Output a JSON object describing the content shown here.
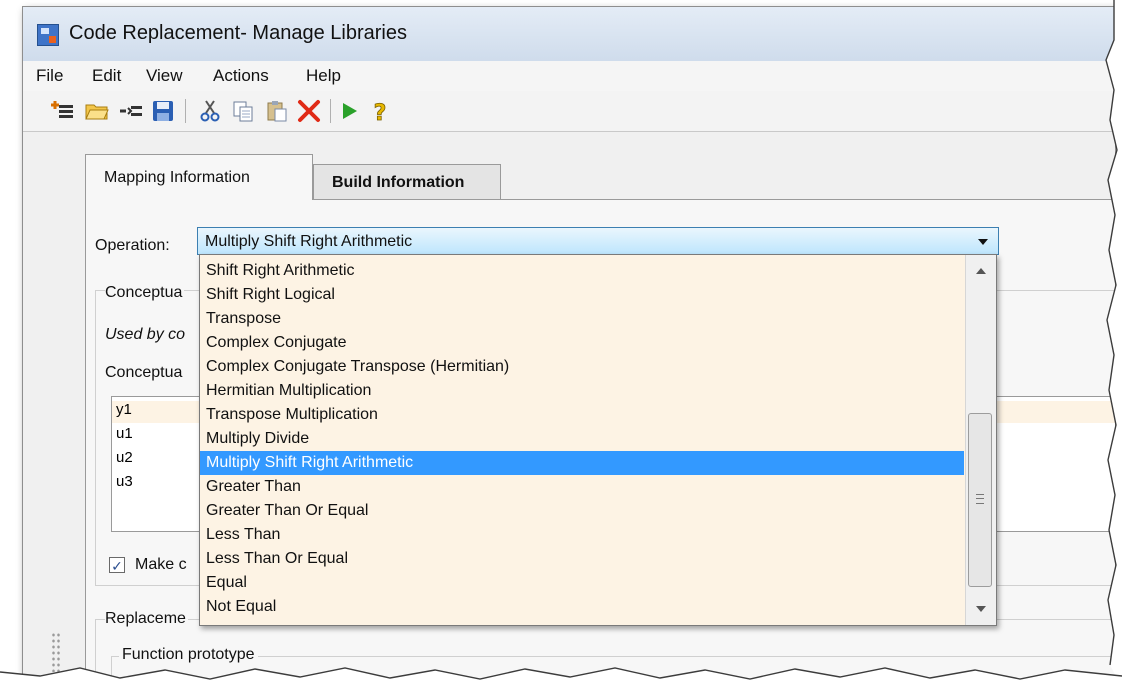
{
  "window": {
    "title": "Code Replacement- Manage Libraries"
  },
  "menu": [
    "File",
    "Edit",
    "View",
    "Actions",
    "Help"
  ],
  "toolbar": {
    "icons": [
      "new-table-icon",
      "open-folder-icon",
      "new-entry-icon",
      "save-icon",
      "cut-icon",
      "copy-icon",
      "paste-icon",
      "delete-icon",
      "validate-icon",
      "help-icon"
    ],
    "colors": {
      "delete": "#e02a16",
      "run": "#2aa12a",
      "help": "#e8b800",
      "save": "#2b5fb3"
    }
  },
  "tabs": {
    "mapping": "Mapping Information",
    "build": "Build Information"
  },
  "operation": {
    "label": "Operation:",
    "selected": "Multiply Shift Right Arithmetic",
    "options": [
      "Shift Right Arithmetic",
      "Shift Right Logical",
      "Transpose",
      "Complex Conjugate",
      "Complex Conjugate Transpose (Hermitian)",
      "Hermitian Multiplication",
      "Transpose Multiplication",
      "Multiply Divide",
      "Multiply Shift Right Arithmetic",
      "Greater Than",
      "Greater Than Or Equal",
      "Less Than",
      "Less Than Or Equal",
      "Equal",
      "Not Equal"
    ],
    "selected_index": 8
  },
  "background": {
    "conceptual_group_partial": "Conceptua",
    "used_by_partial": "Used by co",
    "conceptual_args_partial": "Conceptua",
    "arguments": [
      "y1",
      "u1",
      "u2",
      "u3"
    ],
    "make_checkbox_partial": "Make c",
    "replacement_partial": "Replaceme",
    "function_prototype": "Function prototype"
  },
  "colors": {
    "dropdown_bg": "#fdf3e4",
    "selection": "#3399ff",
    "title_bar": "#dbe6f4",
    "select_border": "#3c7fb1"
  }
}
